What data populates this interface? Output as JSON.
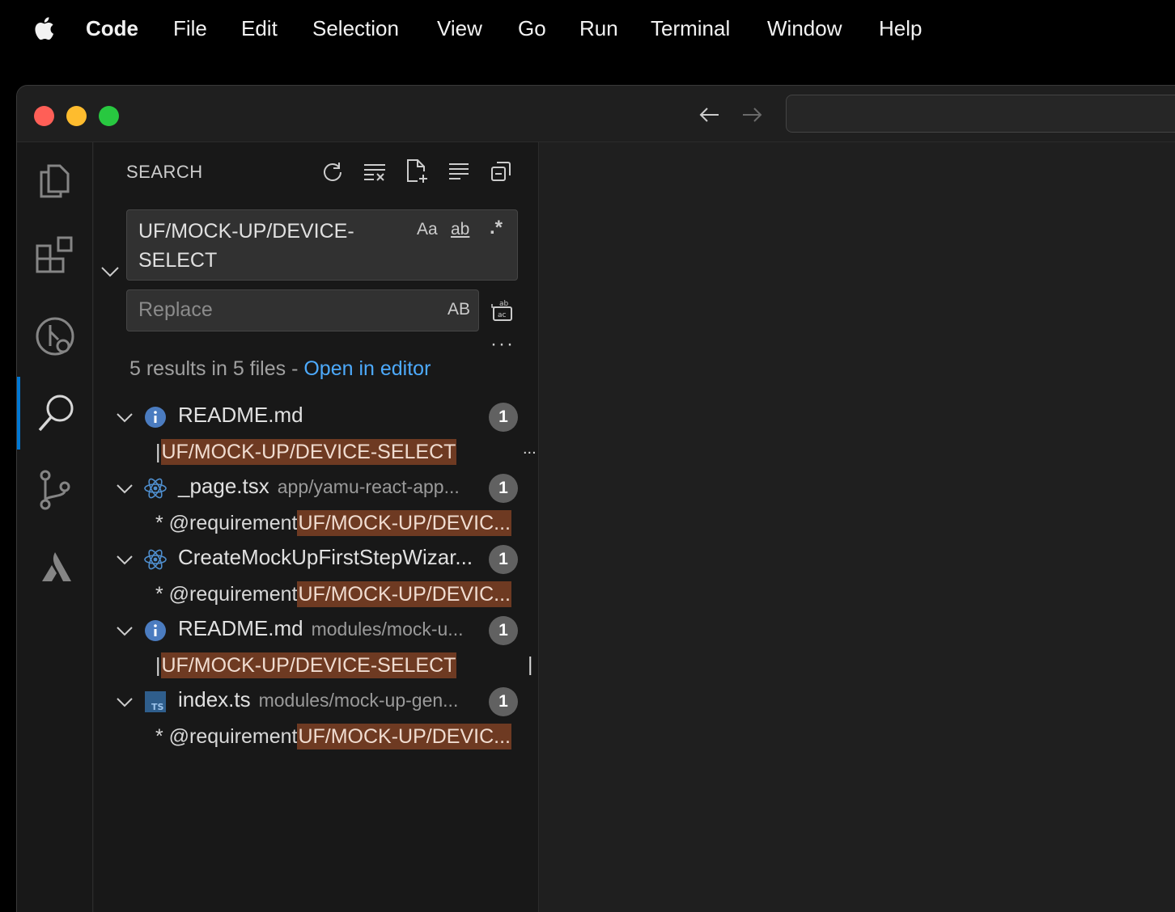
{
  "menubar": {
    "apple_icon": "apple-logo-icon",
    "app_name": "Code",
    "items": [
      "File",
      "Edit",
      "Selection",
      "View",
      "Go",
      "Run",
      "Terminal",
      "Window",
      "Help"
    ]
  },
  "colors": {
    "accent": "#0078d4",
    "link": "#4daafc",
    "highlight": "#6e3a22",
    "close": "#ff5f57",
    "minimize": "#febc2e",
    "maximize": "#28c840"
  },
  "activity_bar": {
    "items": [
      "explorer-icon",
      "extensions-icon",
      "git-graph-icon",
      "search-icon",
      "source-control-icon",
      "atlassian-icon"
    ],
    "active": "search-icon"
  },
  "sidebar": {
    "title": "SEARCH",
    "actions": [
      "refresh-icon",
      "clear-results-icon",
      "new-search-editor-icon",
      "view-as-tree-icon",
      "collapse-all-icon"
    ],
    "search": {
      "value": "UF/MOCK-UP/DEVICE-SELECT",
      "match_case": "Aa",
      "whole_word": "ab",
      "regex": ".*"
    },
    "replace": {
      "placeholder": "Replace",
      "preserve_case": "AB"
    },
    "more": "···",
    "summary": {
      "text": "5 results in 5 files - ",
      "link": "Open in editor"
    },
    "results": [
      {
        "file": "README.md",
        "path": "",
        "icon": "info-icon",
        "count": "1",
        "prefix": "| ",
        "match": "UF/MOCK-UP/DEVICE-SELECT",
        "trail": "..."
      },
      {
        "file": "_page.tsx",
        "path": "app/yamu-react-app...",
        "icon": "react-icon",
        "count": "1",
        "prefix": "* @requirement ",
        "match": "UF/MOCK-UP/DEVIC...",
        "trail": ""
      },
      {
        "file": "CreateMockUpFirstStepWizar...",
        "path": "",
        "icon": "react-icon",
        "count": "1",
        "prefix": "* @requirement ",
        "match": "UF/MOCK-UP/DEVIC...",
        "trail": ""
      },
      {
        "file": "README.md",
        "path": "modules/mock-u...",
        "icon": "info-icon",
        "count": "1",
        "prefix": "| ",
        "match": "UF/MOCK-UP/DEVICE-SELECT",
        "trail": "|"
      },
      {
        "file": "index.ts",
        "path": "modules/mock-up-gen...",
        "icon": "typescript-icon",
        "count": "1",
        "prefix": "* @requirement ",
        "match": "UF/MOCK-UP/DEVIC...",
        "trail": ""
      }
    ]
  }
}
